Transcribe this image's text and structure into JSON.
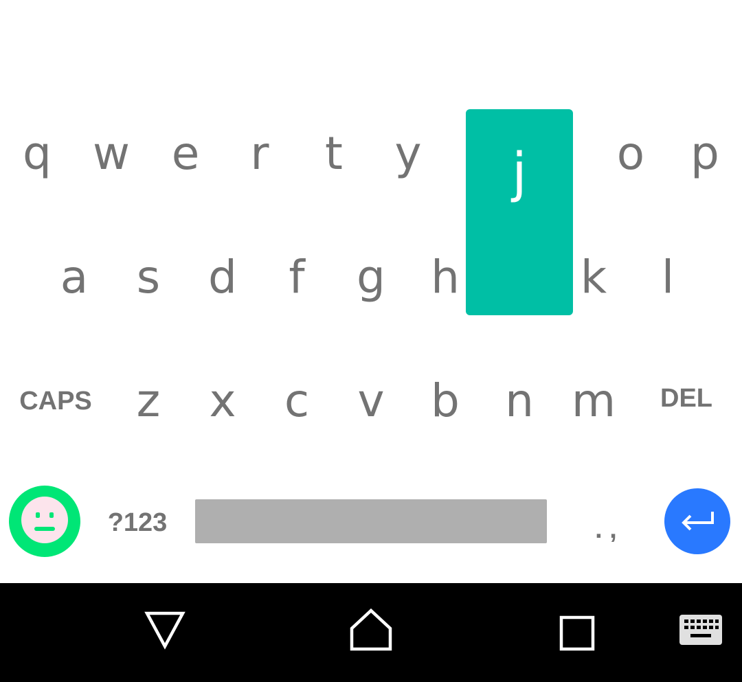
{
  "keyboard": {
    "row1": [
      "q",
      "w",
      "e",
      "r",
      "t",
      "y",
      "o",
      "p"
    ],
    "row2": [
      "a",
      "s",
      "d",
      "f",
      "g",
      "h",
      "k",
      "l"
    ],
    "row3": [
      "z",
      "x",
      "c",
      "v",
      "b",
      "n",
      "m"
    ],
    "pressed_key": "j",
    "caps_label": "CAPS",
    "del_label": "DEL",
    "symbols_label": "?123",
    "punctuation_label": ". ,"
  },
  "nav_bar": {
    "buttons": [
      "back-icon",
      "home-icon",
      "recents-icon",
      "keyboard-icon"
    ]
  },
  "colors": {
    "pressed_key_bg": "#00bfa5",
    "emoji_bg": "#00e676",
    "enter_bg": "#2979ff",
    "space_bar": "#afafaf",
    "key_text": "#737373",
    "nav_bg": "#000000"
  }
}
